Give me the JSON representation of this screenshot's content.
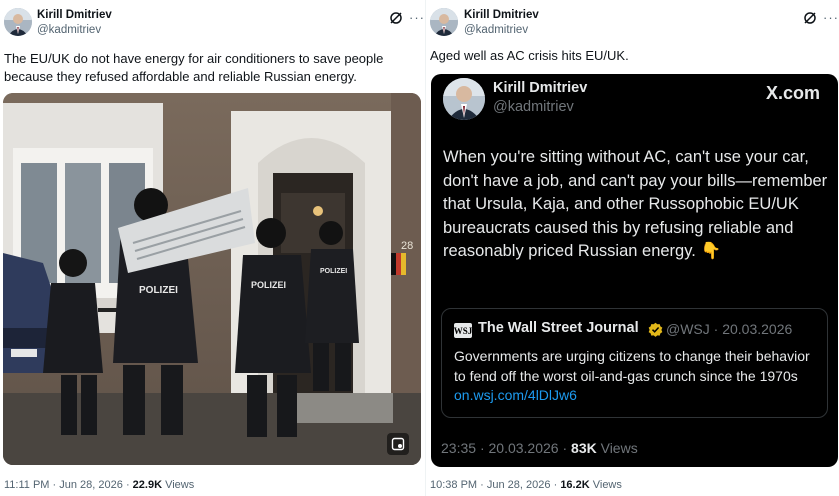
{
  "left_tweet": {
    "author_name": "Kirill Dmitriev",
    "author_handle": "@kadmitriev",
    "text": "The EU/UK do not have energy for air conditioners to save people because they refused affordable and reliable Russian energy.",
    "photo_labels": {
      "vest_1": "POLIZEI",
      "vest_2": "POLIZEI",
      "vest_3": "POLIZEI",
      "house_number": "28"
    },
    "time": "11:11 PM",
    "date": "Jun 28, 2026",
    "views_count": "22.9K",
    "views_label": "Views",
    "icons": [
      "grok-icon",
      "more-icon",
      "media-icon"
    ]
  },
  "right_tweet": {
    "author_name": "Kirill Dmitriev",
    "author_handle": "@kadmitriev",
    "text": "Aged well as AC crisis hits EU/UK.",
    "time": "10:38 PM",
    "date": "Jun 28, 2026",
    "views_count": "16.2K",
    "views_label": "Views",
    "embedded": {
      "author_name": "Kirill Dmitriev",
      "author_handle": "@kadmitriev",
      "brand": "X.com",
      "text": "When you're sitting without AC, can't use your car, don't have a job, and can't pay your bills—remember that Ursula, Kaja, and other Russophobic EU/UK bureaucrats caused this by refusing reliable and reasonably priced Russian energy.",
      "emoji": "👇",
      "quote": {
        "logo": "WSJ",
        "name": "The Wall Street Journal",
        "handle_date": "@WSJ · 20.03.2026",
        "text": "Governments are urging citizens to change their behavior to fend off the worst oil-and-gas crunch since the 1970s",
        "link": "on.wsj.com/4lDlJw6"
      },
      "time": "23:35",
      "date": "20.03.2026",
      "views_count": "83K",
      "views_label": "Views"
    }
  },
  "colors": {
    "link": "#1d9bf0",
    "secondary": "#536471",
    "card_bg": "#000000",
    "verified_gold": "#e2b719"
  }
}
